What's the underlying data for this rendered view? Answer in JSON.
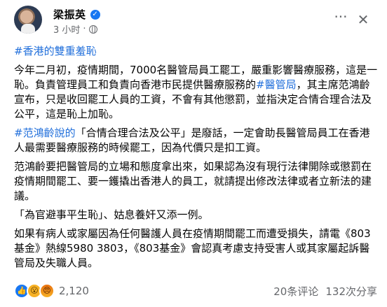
{
  "header": {
    "author": "梁振英",
    "time": "3 小时"
  },
  "body": [
    [
      {
        "t": "#香港的雙重羞恥",
        "tag": true
      }
    ],
    [
      {
        "t": "今年二月初，疫情期間，7000名醫管局員工罷工，嚴重影響醫療服務，這是一恥。負責管理員工和負責向香港市民提供醫療服務的",
        "tag": false
      },
      {
        "t": "#醫管局",
        "tag": true
      },
      {
        "t": "，其主席范鴻齡宣布，只是收回罷工人員的工資，不會有其他懲罰，並指決定合情合理合法及公平，這是恥上加恥。",
        "tag": false
      }
    ],
    [
      {
        "t": "#范鴻齡說的",
        "tag": true
      },
      {
        "t": "「合情合理合法及公平」是廢話，一定會助長醫管局員工在香港人最需要醫療服務的時候罷工，因為代價只是扣工資。",
        "tag": false
      }
    ],
    [
      {
        "t": "范鴻齡要把醫管局的立場和態度拿出來，如果認為沒有現行法律開除或懲罰在疫情期間罷工、要一鑊撬出香港人的員工，就請提出修改法律或者立新法的建議。",
        "tag": false
      }
    ],
    [
      {
        "t": "「為官避事平生恥」、姑息養奸又添一例。",
        "tag": false
      }
    ],
    [
      {
        "t": "如果有病人或家屬因為任何醫護人員在疫情期間罷工而遭受損失，請電《803基金》熱線5980 3803，《803基金》會認真考慮支持受害人或其家屬起訴醫管局及失職人員。",
        "tag": false
      }
    ]
  ],
  "footer": {
    "reaction_count": "2,120",
    "comments": "20条评论",
    "shares": "132次分享"
  },
  "icons": {
    "like": "like-icon",
    "wow": "wow-icon",
    "angry": "angry-icon",
    "verified": "verified-badge-icon",
    "globe": "globe-icon"
  }
}
